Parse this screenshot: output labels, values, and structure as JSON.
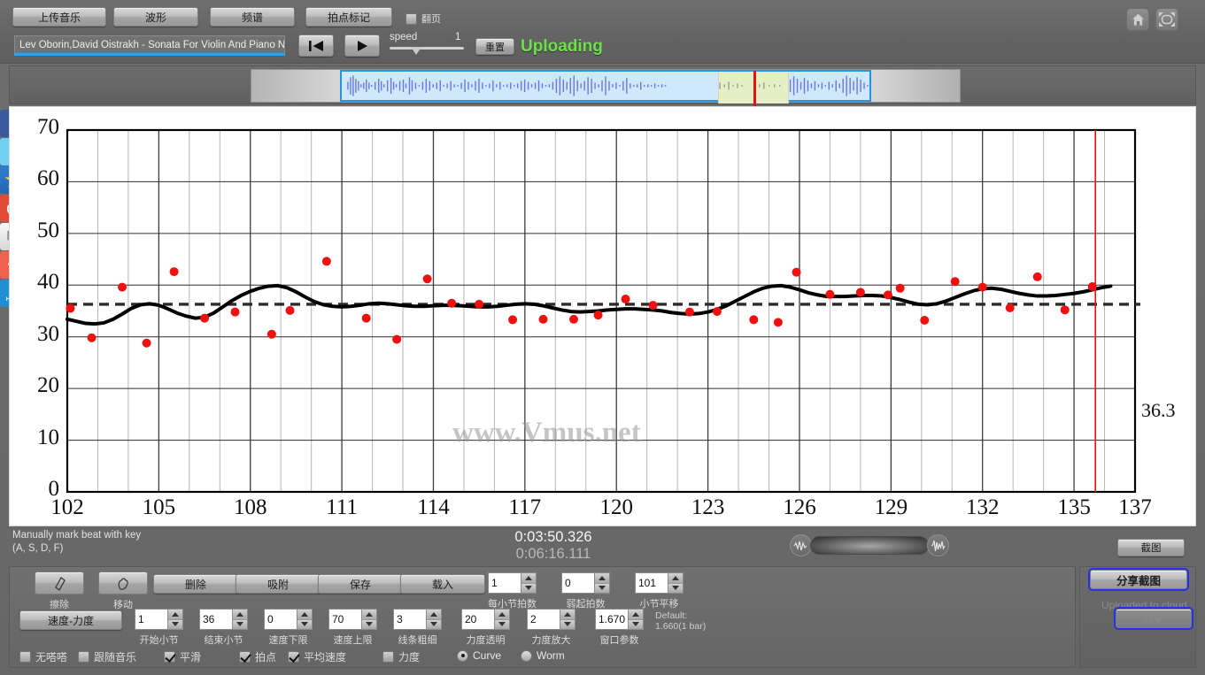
{
  "app": {
    "watermark": "www.Vmus.net"
  },
  "toolbar": {
    "buttons": [
      {
        "name": "upload-music",
        "label": "上传音乐"
      },
      {
        "name": "waveform",
        "label": "波形"
      },
      {
        "name": "spectrum",
        "label": "频谱"
      },
      {
        "name": "beat-mark",
        "label": "拍点标记"
      }
    ],
    "page_turn_checkbox": {
      "label": "翻页",
      "checked": false
    },
    "track_title": "Lev Oborin,David Oistrakh - Sonata For Violin And Piano No.",
    "rewind_icon": "skip-to-start-icon",
    "play_icon": "play-icon",
    "speed_label": "speed",
    "speed_value": "1",
    "reset_label": "重置",
    "status": "Uploading",
    "status_color": "#6ee04a",
    "home_icon": "home-icon",
    "fullscreen_icon": "fullscreen-icon"
  },
  "social": [
    {
      "name": "facebook",
      "glyph": "f"
    },
    {
      "name": "twitter",
      "glyph": "t"
    },
    {
      "name": "qzone",
      "glyph": "★"
    },
    {
      "name": "weibo",
      "glyph": "◉"
    },
    {
      "name": "email",
      "glyph": "✉"
    },
    {
      "name": "share-more",
      "glyph": "+"
    },
    {
      "name": "help",
      "glyph": "?",
      "sub": "HELP"
    }
  ],
  "chart_data": {
    "type": "line",
    "title": "",
    "xlabel": "",
    "ylabel": "",
    "xlim": [
      102,
      137
    ],
    "ylim": [
      0,
      70
    ],
    "grid": true,
    "xticks": [
      102,
      105,
      108,
      111,
      114,
      117,
      120,
      123,
      126,
      129,
      132,
      135,
      137
    ],
    "yticks": [
      0,
      10,
      20,
      30,
      40,
      50,
      60,
      70
    ],
    "minor_x_step": 1,
    "average_line": {
      "value": 36.3,
      "label": "36.3",
      "style": "dashed",
      "color": "#2b2b2b"
    },
    "playhead": {
      "x": 135.7,
      "color": "#e81010"
    },
    "series": [
      {
        "name": "smoothed tempo curve",
        "type": "line",
        "color": "#000000",
        "width": 4,
        "x": [
          102.0,
          102.3,
          102.6,
          102.9,
          103.2,
          103.5,
          103.8,
          104.1,
          104.4,
          104.7,
          105.0,
          105.3,
          105.6,
          105.9,
          106.2,
          106.5,
          106.8,
          107.1,
          107.4,
          107.7,
          108.0,
          108.3,
          108.6,
          108.9,
          109.2,
          109.5,
          109.8,
          110.1,
          110.4,
          110.7,
          111.0,
          111.3,
          111.6,
          111.9,
          112.2,
          112.5,
          112.8,
          113.1,
          113.4,
          113.7,
          114.0,
          114.3,
          114.6,
          114.9,
          115.2,
          115.5,
          115.8,
          116.1,
          116.4,
          116.7,
          117.0,
          117.3,
          117.6,
          117.9,
          118.2,
          118.5,
          118.8,
          119.1,
          119.4,
          119.7,
          120.0,
          120.3,
          120.6,
          120.9,
          121.2,
          121.5,
          121.8,
          122.1,
          122.4,
          122.7,
          123.0,
          123.3,
          123.6,
          123.9,
          124.2,
          124.5,
          124.8,
          125.1,
          125.4,
          125.7,
          126.0,
          126.3,
          126.6,
          126.9,
          127.2,
          127.5,
          127.8,
          128.1,
          128.4,
          128.7,
          129.0,
          129.3,
          129.6,
          129.9,
          130.2,
          130.5,
          130.8,
          131.1,
          131.4,
          131.7,
          132.0,
          132.3,
          132.6,
          132.9,
          133.2,
          133.5,
          133.8,
          134.1,
          134.4,
          134.7,
          135.0,
          135.3,
          135.6,
          135.9,
          136.2
        ],
        "y": [
          33.4,
          33.0,
          32.6,
          32.5,
          32.7,
          33.4,
          34.4,
          35.5,
          36.2,
          36.4,
          36.1,
          35.4,
          34.6,
          34.0,
          33.6,
          33.8,
          34.6,
          35.8,
          37.0,
          38.0,
          38.8,
          39.4,
          39.8,
          39.9,
          39.5,
          38.7,
          37.7,
          36.8,
          36.2,
          35.9,
          35.8,
          35.9,
          36.1,
          36.4,
          36.5,
          36.4,
          36.2,
          36.0,
          35.9,
          35.9,
          36.0,
          36.1,
          36.1,
          36.0,
          35.9,
          35.8,
          35.8,
          35.9,
          36.1,
          36.3,
          36.4,
          36.3,
          36.0,
          35.6,
          35.2,
          34.9,
          34.8,
          34.9,
          35.0,
          35.2,
          35.3,
          35.4,
          35.4,
          35.3,
          35.2,
          35.0,
          34.7,
          34.5,
          34.4,
          34.5,
          34.8,
          35.3,
          36.0,
          36.9,
          37.8,
          38.7,
          39.4,
          39.8,
          39.9,
          39.6,
          39.1,
          38.5,
          38.1,
          37.8,
          37.8,
          37.8,
          37.9,
          38.0,
          38.0,
          37.9,
          37.6,
          37.2,
          36.7,
          36.3,
          36.2,
          36.4,
          36.9,
          37.6,
          38.3,
          38.9,
          39.3,
          39.4,
          39.2,
          38.8,
          38.4,
          38.1,
          37.9,
          37.9,
          38.0,
          38.2,
          38.4,
          38.7,
          39.1,
          39.5,
          39.8
        ]
      },
      {
        "name": "measured beat tempo",
        "type": "scatter",
        "color": "#f01010",
        "size": 5,
        "points": [
          [
            102.1,
            35.5
          ],
          [
            102.8,
            29.8
          ],
          [
            103.8,
            39.6
          ],
          [
            104.6,
            28.8
          ],
          [
            105.5,
            42.6
          ],
          [
            106.5,
            33.6
          ],
          [
            107.5,
            34.8
          ],
          [
            108.7,
            30.5
          ],
          [
            109.3,
            35.1
          ],
          [
            110.5,
            44.6
          ],
          [
            111.8,
            33.6
          ],
          [
            112.8,
            29.5
          ],
          [
            113.8,
            41.2
          ],
          [
            114.6,
            36.5
          ],
          [
            115.5,
            36.3
          ],
          [
            116.6,
            33.3
          ],
          [
            117.6,
            33.4
          ],
          [
            118.6,
            33.4
          ],
          [
            119.4,
            34.2
          ],
          [
            120.3,
            37.3
          ],
          [
            121.2,
            36.1
          ],
          [
            122.4,
            34.8
          ],
          [
            123.3,
            34.9
          ],
          [
            124.5,
            33.3
          ],
          [
            125.3,
            32.8
          ],
          [
            125.9,
            42.5
          ],
          [
            127.0,
            38.2
          ],
          [
            128.0,
            38.6
          ],
          [
            128.9,
            38.1
          ],
          [
            129.3,
            39.4
          ],
          [
            130.1,
            33.2
          ],
          [
            131.1,
            40.7
          ],
          [
            132.0,
            39.6
          ],
          [
            132.9,
            35.6
          ],
          [
            133.8,
            41.6
          ],
          [
            134.7,
            35.2
          ],
          [
            135.6,
            39.7
          ]
        ]
      }
    ]
  },
  "status": {
    "hint_line1": "Manually mark beat with key",
    "hint_line2": "(A, S, D, F)",
    "time_current": "0:03:50.326",
    "time_total": "0:06:16.111",
    "vol_low_icon": "waveform-small-icon",
    "vol_high_icon": "waveform-large-icon",
    "screenshot_label": "截图"
  },
  "right_panel": {
    "share_label": "分享截图",
    "cloud_text": "Uploaded to cloud",
    "share2_label": "分享"
  },
  "bottom": {
    "tools": [
      {
        "name": "erase-tool",
        "icon": "eraser-icon",
        "label": "擦除"
      },
      {
        "name": "move-tool",
        "icon": "hand-move-icon",
        "label": "移动"
      }
    ],
    "row1_buttons": [
      {
        "name": "delete-button",
        "label": "删除"
      },
      {
        "name": "snap-button",
        "label": "吸附"
      },
      {
        "name": "save-button",
        "label": "保存"
      },
      {
        "name": "load-button",
        "label": "载入"
      }
    ],
    "row1_spinners": [
      {
        "name": "beats-per-bar",
        "value": "1",
        "label": "每小节拍数"
      },
      {
        "name": "pickup-beats",
        "value": "0",
        "label": "弱起拍数"
      },
      {
        "name": "bar-shift",
        "value": "101",
        "label": "小节平移"
      }
    ],
    "velocity_dynamics_label": "速度-力度",
    "row2_spinners": [
      {
        "name": "start-bar",
        "value": "1",
        "label": "开始小节"
      },
      {
        "name": "end-bar",
        "value": "36",
        "label": "结束小节"
      },
      {
        "name": "tempo-min",
        "value": "0",
        "label": "速度下限"
      },
      {
        "name": "tempo-max",
        "value": "70",
        "label": "速度上限"
      },
      {
        "name": "line-thickness",
        "value": "3",
        "label": "线条粗细"
      },
      {
        "name": "dynamics-alpha",
        "value": "20",
        "label": "力度透明"
      },
      {
        "name": "dynamics-scale",
        "value": "2",
        "label": "力度放大"
      },
      {
        "name": "window-param",
        "value": "1.6707",
        "label": "窗口参数"
      }
    ],
    "default_line1": "Default:",
    "default_line2": "1.660(1 bar)",
    "checkboxes": [
      {
        "name": "no-metronome",
        "label": "无嗒嗒",
        "checked": false
      },
      {
        "name": "follow-music",
        "label": "跟随音乐",
        "checked": false
      },
      {
        "name": "smooth",
        "label": "平滑",
        "checked": true
      },
      {
        "name": "beats",
        "label": "拍点",
        "checked": true
      },
      {
        "name": "average-tempo",
        "label": "平均速度",
        "checked": true
      },
      {
        "name": "dynamics",
        "label": "力度",
        "checked": false
      }
    ],
    "radios": [
      {
        "name": "curve",
        "label": "Curve",
        "selected": true
      },
      {
        "name": "worm",
        "label": "Worm",
        "selected": false
      }
    ]
  }
}
